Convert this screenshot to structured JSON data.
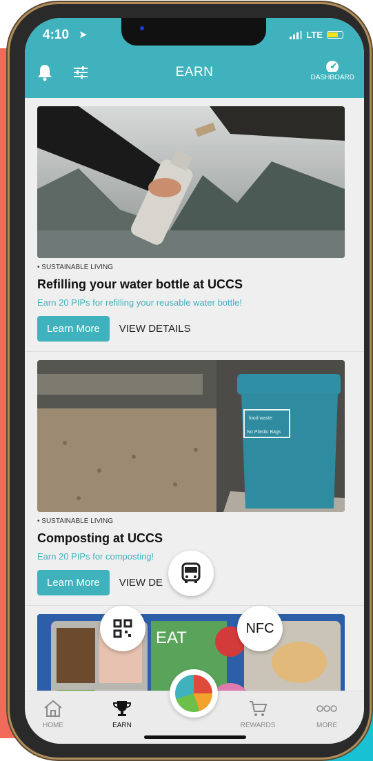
{
  "status": {
    "time": "4:10",
    "network": "LTE"
  },
  "header": {
    "title": "EARN",
    "dashboard_label": "DASHBOARD"
  },
  "cards": [
    {
      "category": "• SUSTAINABLE LIVING",
      "title": "Refilling your water bottle at UCCS",
      "desc": "Earn 20 PIPs for refilling your reusable water bottle!",
      "learn_label": "Learn More",
      "details_label": "VIEW DETAILS"
    },
    {
      "category": "• SUSTAINABLE LIVING",
      "title": "Composting at UCCS",
      "desc": "Earn 20 PIPs for composting!",
      "learn_label": "Learn More",
      "details_label": "VIEW DE",
      "bin_label_1": "food waste",
      "bin_label_2": "No Plastic Bags"
    },
    {
      "banner_text": "EAT"
    }
  ],
  "floating": {
    "nfc_label": "NFC"
  },
  "tabs": [
    {
      "label": "HOME"
    },
    {
      "label": "EARN"
    },
    {
      "label": "REWARDS"
    },
    {
      "label": "MORE"
    }
  ],
  "colors": {
    "accent": "#3fb2bd",
    "coral": "#f26a5a",
    "teal": "#19c2d3"
  }
}
